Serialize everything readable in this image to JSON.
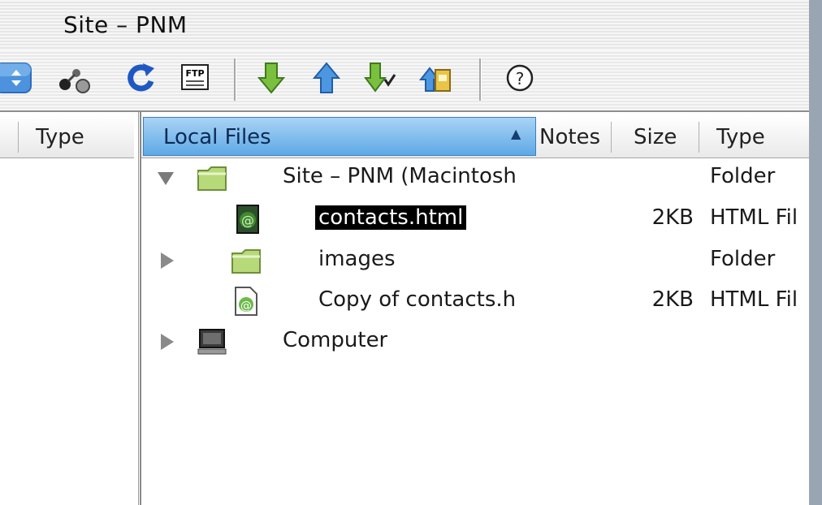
{
  "window": {
    "title": "Site – PNM"
  },
  "toolbar": {
    "buttons": [
      {
        "name": "site-popup-button",
        "icon": "popup-arrows-icon"
      },
      {
        "name": "connect-button",
        "icon": "connect-icon"
      },
      {
        "name": "refresh-button",
        "icon": "refresh-icon"
      },
      {
        "name": "ftp-log-button",
        "icon": "ftp-icon",
        "label": "FTP"
      },
      {
        "name": "get-button",
        "icon": "down-arrow-icon"
      },
      {
        "name": "put-button",
        "icon": "up-arrow-icon"
      },
      {
        "name": "check-out-button",
        "icon": "check-out-icon"
      },
      {
        "name": "check-in-button",
        "icon": "check-in-icon"
      },
      {
        "name": "help-button",
        "icon": "help-icon",
        "label": "?"
      }
    ]
  },
  "remote_pane": {
    "columns": [
      "Type"
    ]
  },
  "local_pane": {
    "columns": {
      "local_files": "Local Files",
      "notes": "Notes",
      "size": "Size",
      "type": "Type"
    },
    "rows": [
      {
        "name": "Site – PNM (Macintosh",
        "size": "",
        "type": "Folder",
        "icon": "folder-icon",
        "expander": "expanded"
      },
      {
        "name": "contacts.html",
        "size": "2KB",
        "type": "HTML Fil",
        "icon": "html-file-icon",
        "selected": true
      },
      {
        "name": "images",
        "size": "",
        "type": "Folder",
        "icon": "folder-icon",
        "expander": "collapsed"
      },
      {
        "name": "Copy of contacts.h",
        "size": "2KB",
        "type": "HTML Fil",
        "icon": "html-file-icon"
      },
      {
        "name": "Computer",
        "size": "",
        "type": "",
        "icon": "computer-icon",
        "expander": "collapsed"
      }
    ]
  },
  "colors": {
    "header_selected": "#5ea9e6",
    "selection": "#000000",
    "folder": "#b7d97a"
  }
}
